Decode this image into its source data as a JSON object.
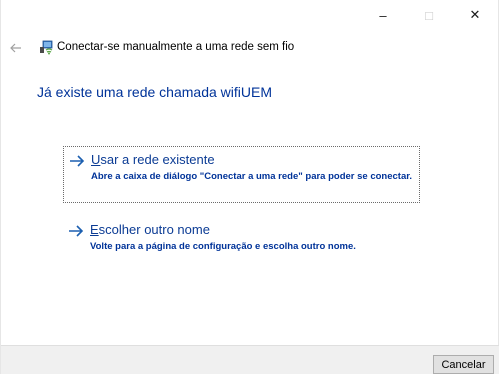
{
  "window": {
    "caption": {
      "minimize_glyph": "–",
      "maximize_glyph": "□",
      "close_glyph": "✕"
    }
  },
  "header": {
    "back_icon": "back-arrow-icon",
    "wizard_icon": "network-icon",
    "title": "Conectar-se manualmente a uma rede sem fio"
  },
  "main_instruction": "Já existe uma rede chamada wifiUEM",
  "options": [
    {
      "accelerator": "U",
      "title_rest": "sar a rede existente",
      "description": "Abre a caixa de diálogo \"Conectar a uma rede\" para poder se conectar.",
      "focused": true
    },
    {
      "accelerator": "E",
      "title_rest": "scolher outro nome",
      "description": "Volte para a página de configuração e escolha outro nome.",
      "focused": false
    }
  ],
  "footer": {
    "cancel_label": "Cancelar"
  },
  "colors": {
    "instruction": "#003399",
    "link": "#0b3b94",
    "arrow": "#1c5fb0",
    "footer_bg": "#f0f0f0"
  }
}
